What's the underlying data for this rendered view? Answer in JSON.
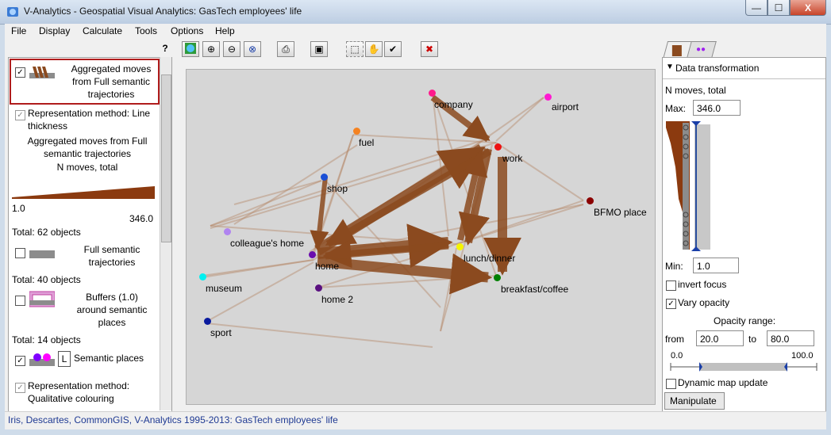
{
  "window": {
    "title": "V-Analytics - Geospatial Visual Analytics: GasTech employees' life",
    "controls": {
      "minimize": "—",
      "maximize": "☐",
      "close": "X"
    }
  },
  "menubar": {
    "items": [
      "File",
      "Display",
      "Calculate",
      "Tools",
      "Options",
      "Help"
    ]
  },
  "toolbar": {
    "help_label": "?"
  },
  "left_panel": {
    "layer1": {
      "title": "Aggregated moves from Full semantic trajectories",
      "checked": true
    },
    "layer1_method": "Representation method: Line thickness",
    "layer1_legend_title": "Aggregated moves from Full semantic trajectories",
    "layer1_attribute": "N moves, total",
    "layer1_min": "1.0",
    "layer1_max": "346.0",
    "layer2_total": "Total: 62 objects",
    "layer2": {
      "title": "Full semantic trajectories",
      "checked": false
    },
    "layer3_total": "Total: 40 objects",
    "layer3": {
      "title": "Buffers (1.0) around semantic places",
      "checked": false
    },
    "layer4_total": "Total: 14 objects",
    "layer4": {
      "title": "Semantic places",
      "badge": "L",
      "checked": true
    },
    "layer4_method": "Representation method: Qualitative colouring"
  },
  "map": {
    "places": [
      {
        "name": "company",
        "color": "#ff1a8c"
      },
      {
        "name": "airport",
        "color": "#ff1ad1"
      },
      {
        "name": "fuel",
        "color": "#f58220"
      },
      {
        "name": "work",
        "color": "#ee1111"
      },
      {
        "name": "shop",
        "color": "#1a4fd6"
      },
      {
        "name": "BFMO place",
        "color": "#8b0000"
      },
      {
        "name": "colleague's home",
        "color": "#b084f0"
      },
      {
        "name": "home",
        "color": "#6a0dad"
      },
      {
        "name": "lunch/dinner",
        "color": "#f5f500"
      },
      {
        "name": "museum",
        "color": "#00f0f0"
      },
      {
        "name": "breakfast/coffee",
        "color": "#008000"
      },
      {
        "name": "home 2",
        "color": "#5a1080"
      },
      {
        "name": "sport",
        "color": "#0a1a9e"
      }
    ],
    "arrow_color": "#8b4a1f"
  },
  "right_panel": {
    "section_title": "Data transformation",
    "attribute": "N moves, total",
    "max_label": "Max:",
    "max_value": "346.0",
    "min_label": "Min:",
    "min_value": "1.0",
    "invert_focus": {
      "label": "invert focus",
      "checked": false
    },
    "vary_opacity": {
      "label": "Vary opacity",
      "checked": true
    },
    "opacity_range_label": "Opacity range:",
    "from_label": "from",
    "from_value": "20.0",
    "to_label": "to",
    "to_value": "80.0",
    "scale_min": "0.0",
    "scale_max": "100.0",
    "dynamic_update": {
      "label": "Dynamic map update",
      "checked": false
    },
    "manipulate_tab": "Manipulate"
  },
  "statusbar": {
    "text": "Iris, Descartes, CommonGIS, V-Analytics 1995-2013: GasTech employees' life"
  }
}
